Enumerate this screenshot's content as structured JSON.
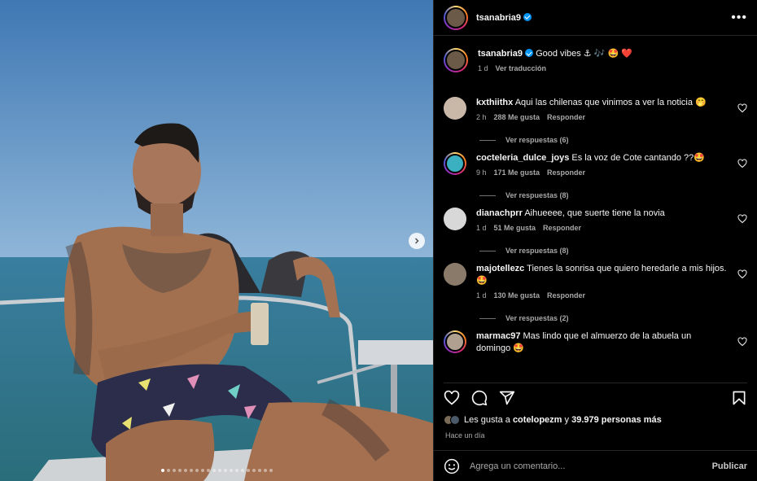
{
  "post": {
    "username": "tsanabria9",
    "more_label": "•••",
    "caption_text": "Good vibes ⚓ 🎶 🤩 ❤️",
    "caption_time": "1 d",
    "translate_label": "Ver traducción"
  },
  "photo": {
    "carousel_total": 20,
    "carousel_active": 1
  },
  "comments": [
    {
      "user": "kxthiithx",
      "text": "Aqui las chilenas que vinimos a ver la noticia 🤭",
      "time": "2 h",
      "likes": "288 Me gusta",
      "reply": "Responder",
      "replies": "Ver respuestas (6)"
    },
    {
      "user": "cocteleria_dulce_joys",
      "text": "Es la voz de Cote cantando ??🤩",
      "time": "9 h",
      "likes": "171 Me gusta",
      "reply": "Responder",
      "replies": "Ver respuestas (8)"
    },
    {
      "user": "dianachprr",
      "text": "Aihueeee, que suerte tiene la novia",
      "time": "1 d",
      "likes": "51 Me gusta",
      "reply": "Responder",
      "replies": "Ver respuestas (8)"
    },
    {
      "user": "majotellezc",
      "text": "Tienes la sonrisa que quiero heredarle a mis hijos. 🤩",
      "time": "1 d",
      "likes": "130 Me gusta",
      "reply": "Responder",
      "replies": "Ver respuestas (2)"
    },
    {
      "user": "marmac97",
      "text": "Mas lindo que el almuerzo de la abuela un domingo 🤩",
      "time": "",
      "likes": "",
      "reply": "",
      "replies": ""
    }
  ],
  "likes": {
    "prefix": "Les gusta a ",
    "user": "cotelopezm",
    "middle": " y ",
    "count": "39.979 personas más"
  },
  "posted_time": "Hace un día",
  "add_comment": {
    "placeholder": "Agrega un comentario...",
    "publish_label": "Publicar"
  },
  "colors": {
    "background": "#000000",
    "verified": "#0095f6",
    "secondary_text": "#a8a8a8",
    "divider": "#262626"
  }
}
